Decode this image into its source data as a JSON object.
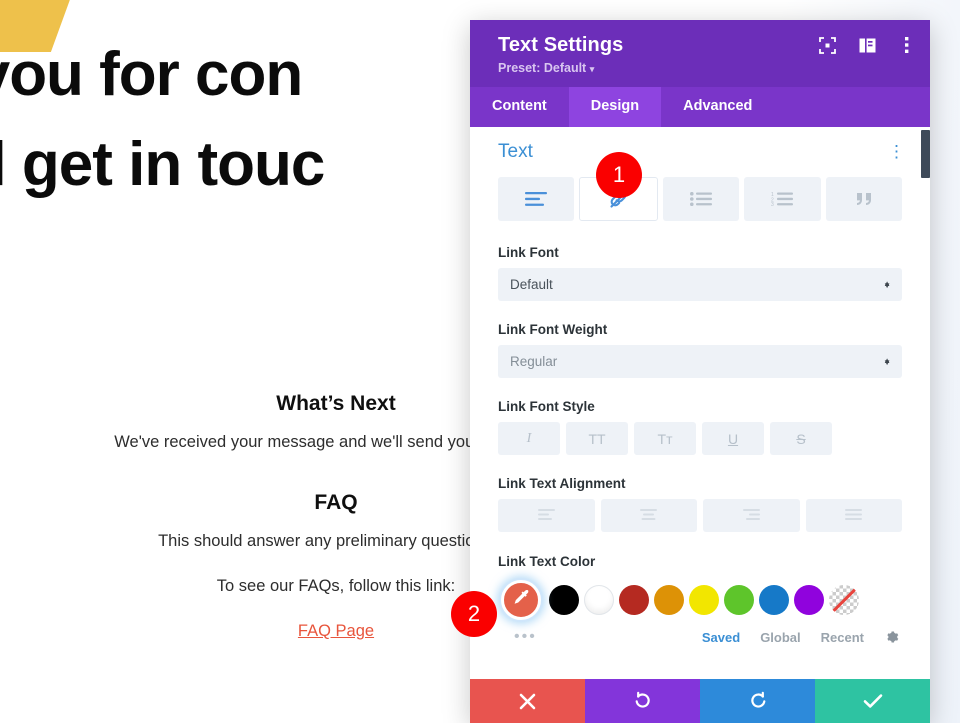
{
  "background_page": {
    "hero_lines": [
      "k you for con",
      "e'll get in touc"
    ],
    "whats_next_heading": "What’s Next",
    "whats_next_text": "We've received your message and we'll send you an email w",
    "faq_heading": "FAQ",
    "faq_text": "This should answer any preliminary questions yo",
    "faq_link_prompt": "To see our FAQs, follow this link:",
    "faq_link_label": "FAQ Page",
    "link_color": "#e8553c",
    "wedge_color": "#eec14b"
  },
  "modal": {
    "title": "Text Settings",
    "preset": "Preset: Default",
    "preset_caret": "▾",
    "header_icons": [
      {
        "name": "focus-icon"
      },
      {
        "name": "layout-split-icon"
      },
      {
        "name": "more-vertical-icon"
      }
    ],
    "tabs": [
      {
        "label": "Content",
        "active": false
      },
      {
        "label": "Design",
        "active": true
      },
      {
        "label": "Advanced",
        "active": false
      }
    ],
    "accent_header": "#6c2eb9",
    "accent_tabbar": "#7a35c9",
    "accent_tab_active": "#8e44e0"
  },
  "section": {
    "title": "Text",
    "kebab": "⋮",
    "segments": [
      {
        "name": "text-align-icon",
        "label": "Text",
        "active": false
      },
      {
        "name": "link-icon",
        "label": "Link",
        "active": true
      },
      {
        "name": "unordered-list-icon",
        "label": "Unordered List",
        "active": false
      },
      {
        "name": "ordered-list-icon",
        "label": "Ordered List",
        "active": false
      },
      {
        "name": "blockquote-icon",
        "label": "Blockquote",
        "active": false
      }
    ]
  },
  "fields": {
    "link_font": {
      "label": "Link Font",
      "value": "Default"
    },
    "link_font_weight": {
      "label": "Link Font Weight",
      "value": "Regular"
    },
    "link_font_style": {
      "label": "Link Font Style",
      "buttons": [
        {
          "name": "italic-button",
          "glyph": "I"
        },
        {
          "name": "uppercase-button",
          "glyph": "TT"
        },
        {
          "name": "small-caps-button",
          "glyph": "Tᴛ"
        },
        {
          "name": "underline-button",
          "glyph": "U"
        },
        {
          "name": "strikethrough-button",
          "glyph": "S"
        }
      ]
    },
    "link_text_alignment": {
      "label": "Link Text Alignment",
      "buttons": [
        {
          "name": "align-left-button"
        },
        {
          "name": "align-center-button"
        },
        {
          "name": "align-right-button"
        },
        {
          "name": "align-justify-button"
        }
      ]
    },
    "link_text_color": {
      "label": "Link Text Color",
      "eyedropper_color": "#e4614a",
      "more_dots": "•••",
      "swatches": [
        {
          "name": "swatch-black",
          "color": "#000000"
        },
        {
          "name": "swatch-white",
          "color": "#ffffff"
        },
        {
          "name": "swatch-dark-red",
          "color": "#b52a21"
        },
        {
          "name": "swatch-amber",
          "color": "#dd9206"
        },
        {
          "name": "swatch-yellow",
          "color": "#f2e600"
        },
        {
          "name": "swatch-green",
          "color": "#5ec52b"
        },
        {
          "name": "swatch-blue",
          "color": "#1679c8"
        },
        {
          "name": "swatch-purple",
          "color": "#9003dd"
        },
        {
          "name": "swatch-transparent",
          "color": "transparent"
        }
      ],
      "palette_tabs": [
        {
          "label": "Saved",
          "active": true
        },
        {
          "label": "Global",
          "active": false
        },
        {
          "label": "Recent",
          "active": false
        }
      ],
      "settings_icon": "gear-icon"
    }
  },
  "action_bar": [
    {
      "name": "cancel-button",
      "icon": "close-icon",
      "color": "#e8544f"
    },
    {
      "name": "undo-button",
      "icon": "undo-icon",
      "color": "#8335da"
    },
    {
      "name": "redo-button",
      "icon": "redo-icon",
      "color": "#2d8ada"
    },
    {
      "name": "save-button",
      "icon": "check-icon",
      "color": "#2ec3a2"
    }
  ],
  "callouts": [
    {
      "name": "callout-badge-1",
      "label": "1"
    },
    {
      "name": "callout-badge-2",
      "label": "2"
    }
  ]
}
